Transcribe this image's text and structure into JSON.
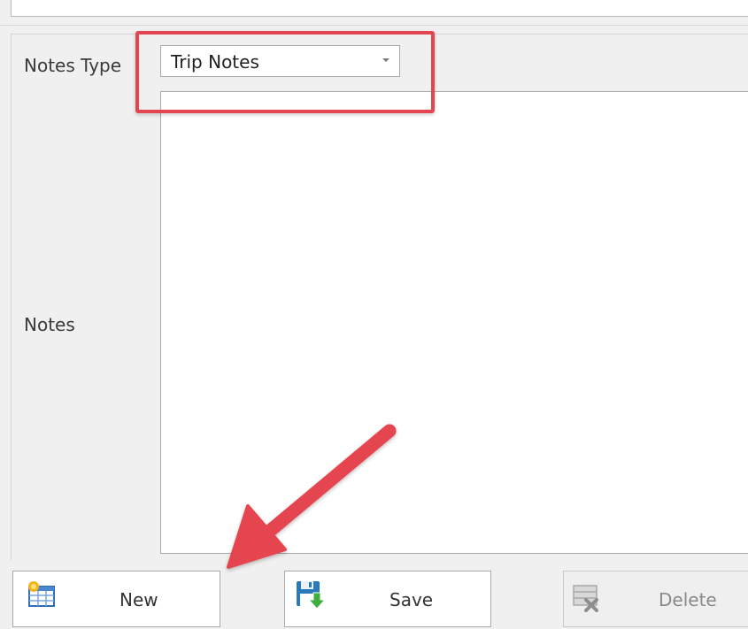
{
  "form": {
    "notes_type_label": "Notes Type",
    "notes_type_value": "Trip Notes",
    "notes_label": "Notes",
    "notes_value": ""
  },
  "buttons": {
    "new_label": "New",
    "save_label": "Save",
    "delete_label": "Delete",
    "delete_enabled": false
  },
  "icons": {
    "new": "new-record-icon",
    "save": "save-disk-icon",
    "delete": "delete-record-icon",
    "dropdown": "chevron-down-icon"
  },
  "annotations": {
    "highlight_color": "#e5454f",
    "arrow_color": "#e5454f",
    "highlight_target": "notes-type-dropdown",
    "arrow_target": "new-button"
  }
}
